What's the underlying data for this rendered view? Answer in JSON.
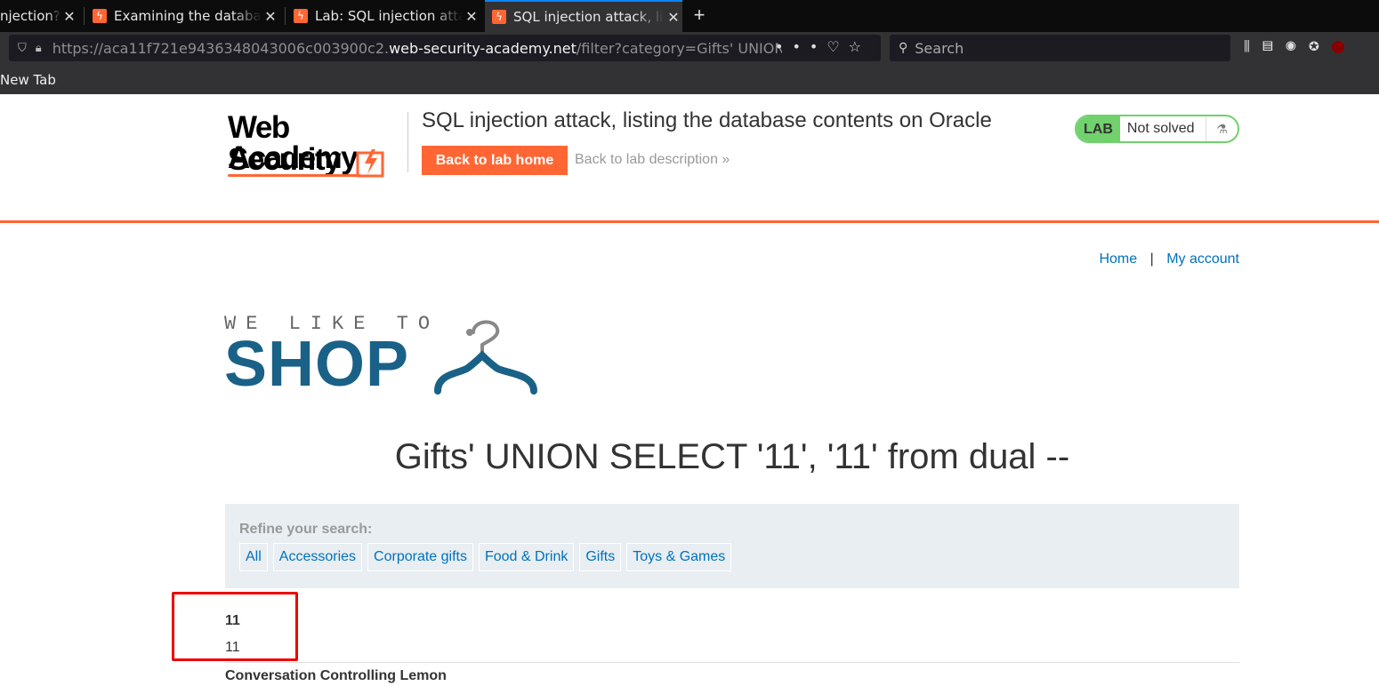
{
  "browser": {
    "tabs": [
      {
        "label": "njection?"
      },
      {
        "label": "Examining the database"
      },
      {
        "label": "Lab: SQL injection attack"
      },
      {
        "label": "SQL injection attack, listing"
      }
    ],
    "url_prefix": "https://aca11f721e9436348043006c003900c2.",
    "url_domain": "web-security-academy.net",
    "url_path": "/filter?category=Gifts' UNION SELECT",
    "search_placeholder": "Search",
    "bookmark": "New Tab"
  },
  "lab": {
    "logo_line1": "Web Security",
    "logo_line2": "Academy",
    "title": "SQL injection attack, listing the database contents on Oracle",
    "back_home": "Back to lab home",
    "back_description": "Back to lab description »",
    "status_label": "LAB",
    "status_value": "Not solved"
  },
  "shop": {
    "nav_home": "Home",
    "nav_sep": "|",
    "nav_account": "My account",
    "logo_top": "WE LIKE TO",
    "logo_main": "SHOP",
    "category_title": "Gifts' UNION SELECT '11', '11' from dual --",
    "refine_label": "Refine your search:",
    "categories": [
      "All",
      "Accessories",
      "Corporate gifts",
      "Food & Drink",
      "Gifts",
      "Toys & Games"
    ],
    "results": [
      {
        "name": "11",
        "description": "11"
      },
      {
        "name": "Conversation Controlling Lemon"
      }
    ]
  },
  "colors": {
    "accent": "#ff6633",
    "link": "#0071bc",
    "brand": "#1a6187",
    "lab_status": "#70d16d",
    "highlight": "#ee0000"
  }
}
